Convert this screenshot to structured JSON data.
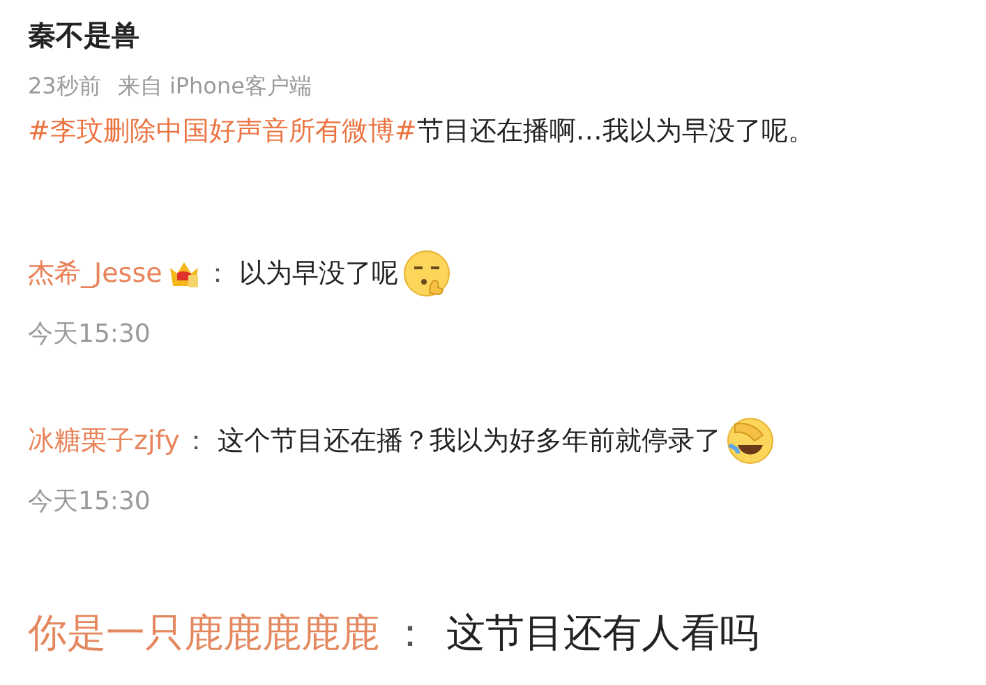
{
  "post": {
    "author": "秦不是兽",
    "time": "23秒前",
    "source": "来自 iPhone客户端",
    "hashtag": "#李玟删除中国好声音所有微博#",
    "text": "节目还在播啊…我以为早没了呢。"
  },
  "comments": [
    {
      "kind": "normal",
      "user": "杰希_Jesse",
      "badge": {
        "kind": "crown"
      },
      "separator": "：",
      "text": "以为早没了呢",
      "emoji": {
        "kind": "shush"
      },
      "time": "今天15:30"
    },
    {
      "kind": "normal",
      "user": "冰糖栗子zjfy",
      "separator": "：",
      "text": "这个节目还在播？我以为好多年前就停录了",
      "emoji": {
        "kind": "facepalm-laugh"
      },
      "time": "今天15:30"
    },
    {
      "kind": "large",
      "user": "你是一只鹿鹿鹿鹿鹿",
      "separator": "：",
      "text": "这节目还有人看吗"
    }
  ]
}
